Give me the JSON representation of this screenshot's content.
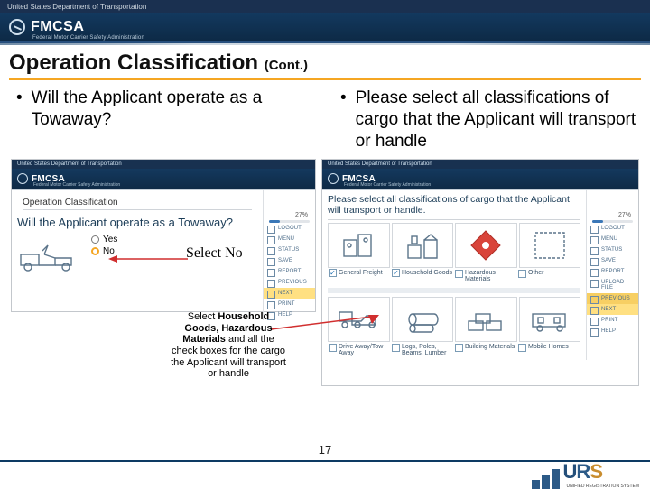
{
  "browser_bar": "United States Department of Transportation",
  "banner": {
    "title": "FMCSA",
    "subtitle": "Federal Motor Carrier Safety Administration"
  },
  "heading": {
    "main": "Operation Classification",
    "cont": "(Cont.)"
  },
  "left_bullet": "Will the Applicant operate as a Towaway?",
  "right_bullet": "Please select all classifications of cargo that the Applicant will transport or handle",
  "panel_left": {
    "section": "Operation Classification",
    "question": "Will the Applicant operate as a Towaway?",
    "options": {
      "yes": "Yes",
      "no": "No"
    },
    "progress": "27%",
    "sidebar": [
      "LOGOUT",
      "MENU",
      "STATUS",
      "SAVE",
      "REPORT",
      "PREVIOUS",
      "NEXT",
      "PRINT",
      "HELP"
    ]
  },
  "panel_right": {
    "question": "Please select all classifications of cargo that the Applicant will transport or handle.",
    "progress": "27%",
    "sidebar": [
      "LOGOUT",
      "MENU",
      "STATUS",
      "SAVE",
      "REPORT",
      "UPLOAD FILE",
      "PREVIOUS",
      "NEXT",
      "PRINT",
      "HELP"
    ],
    "row1_labels": [
      "General Freight",
      "Household Goods",
      "Hazardous Materials",
      "Other"
    ],
    "row1_checked": [
      true,
      true,
      false,
      false
    ],
    "row2_labels": [
      "Drive Away/Tow Away",
      "Logs, Poles, Beams, Lumber",
      "Building Materials",
      "Mobile Homes"
    ],
    "row2_checked": [
      false,
      false,
      false,
      false
    ]
  },
  "annotations": {
    "select_no": "Select No",
    "callout": "Select <b>Household Goods, Hazardous Materials</b> and all the check boxes for the cargo the Applicant will transport or handle"
  },
  "page_number": "17",
  "footer": {
    "logo_text": "URS",
    "logo_sub": "UNIFIED REGISTRATION SYSTEM"
  }
}
